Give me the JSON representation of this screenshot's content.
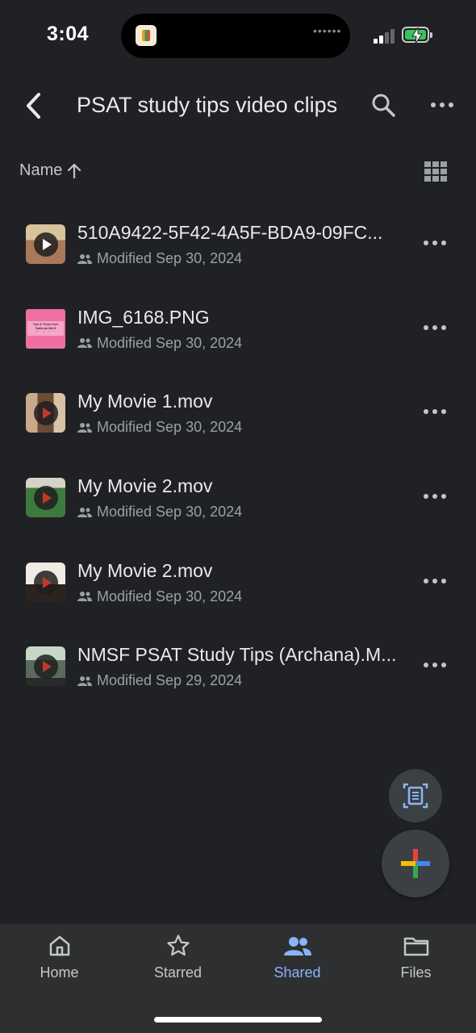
{
  "status_bar": {
    "time": "3:04",
    "battery_level": 0.9,
    "battery_color": "#34c759",
    "signal_bars_active": 2,
    "signal_bars_total": 4
  },
  "header": {
    "title": "PSAT study tips video clips",
    "back_icon": "chevron-left-icon",
    "search_icon": "search-icon",
    "more_icon": "more-horizontal-icon"
  },
  "sort": {
    "label": "Name",
    "direction": "ascending",
    "view_toggle_icon": "grid-view-icon"
  },
  "files": [
    {
      "name": "510A9422-5F42-4A5F-BDA9-09FC...",
      "modified": "Modified Sep 30, 2024",
      "type": "video",
      "thumb_color": "#c9a27a",
      "shared": true
    },
    {
      "name": "IMG_6168.PNG",
      "modified": "Modified Sep 30, 2024",
      "type": "image",
      "thumb_color": "#ef6fa5",
      "thumb_text": "Tips & Tricks from National Merit Semifinalists!",
      "shared": true
    },
    {
      "name": "My Movie 1.mov",
      "modified": "Modified Sep 30, 2024",
      "type": "video",
      "thumb_color": "#b08a70",
      "shared": true
    },
    {
      "name": "My Movie 2.mov",
      "modified": "Modified Sep 30, 2024",
      "type": "video",
      "thumb_color": "#3d7a3e",
      "shared": true
    },
    {
      "name": "My Movie 2.mov",
      "modified": "Modified Sep 30, 2024",
      "type": "video",
      "thumb_color": "#e9e1d6",
      "shared": true
    },
    {
      "name": "NMSF PSAT Study Tips (Archana).M...",
      "modified": "Modified Sep 29, 2024",
      "type": "video",
      "thumb_color": "#9fb4a0",
      "shared": true
    }
  ],
  "fabs": {
    "scan_icon": "document-scan-icon",
    "new_icon": "plus-icon",
    "plus_colors": [
      "#4285f4",
      "#ea4335",
      "#fbbc04",
      "#34a853"
    ]
  },
  "bottom_nav": {
    "items": [
      {
        "label": "Home",
        "icon": "home-icon",
        "active": false
      },
      {
        "label": "Starred",
        "icon": "star-icon",
        "active": false
      },
      {
        "label": "Shared",
        "icon": "people-icon",
        "active": true
      },
      {
        "label": "Files",
        "icon": "folder-icon",
        "active": false
      }
    ],
    "active_color": "#8ab4f8"
  }
}
